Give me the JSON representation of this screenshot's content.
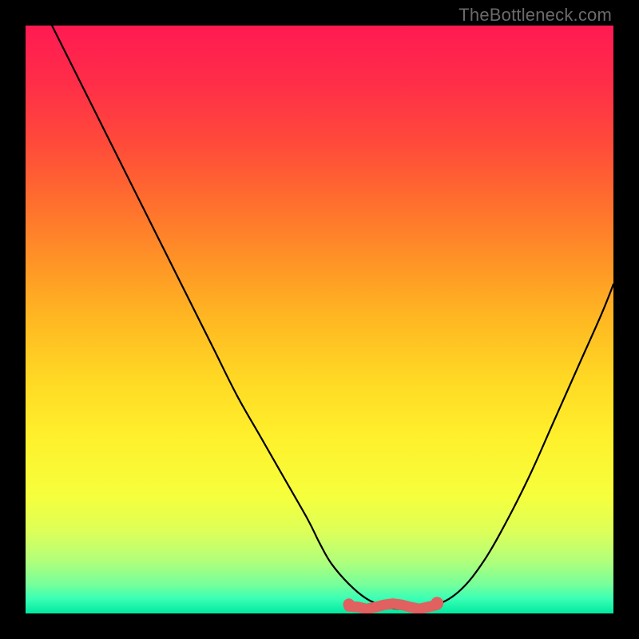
{
  "watermark": {
    "text": "TheBottleneck.com"
  },
  "gradient": {
    "stops": [
      {
        "offset": 0.0,
        "color": "#ff1a52"
      },
      {
        "offset": 0.1,
        "color": "#ff2e48"
      },
      {
        "offset": 0.2,
        "color": "#ff4a3a"
      },
      {
        "offset": 0.3,
        "color": "#ff6e2e"
      },
      {
        "offset": 0.4,
        "color": "#ff9326"
      },
      {
        "offset": 0.5,
        "color": "#ffb822"
      },
      {
        "offset": 0.6,
        "color": "#ffd824"
      },
      {
        "offset": 0.7,
        "color": "#fff02c"
      },
      {
        "offset": 0.8,
        "color": "#f6ff3c"
      },
      {
        "offset": 0.86,
        "color": "#ddff58"
      },
      {
        "offset": 0.91,
        "color": "#b2ff7a"
      },
      {
        "offset": 0.95,
        "color": "#78ff9a"
      },
      {
        "offset": 0.975,
        "color": "#3affb5"
      },
      {
        "offset": 1.0,
        "color": "#00e8a0"
      }
    ]
  },
  "chart_data": {
    "type": "line",
    "title": "",
    "xlabel": "",
    "ylabel": "",
    "xlim": [
      0,
      100
    ],
    "ylim": [
      0,
      100
    ],
    "series": [
      {
        "name": "bottleneck-curve",
        "x": [
          4.5,
          8,
          12,
          16,
          20,
          24,
          28,
          32,
          36,
          40,
          44,
          48,
          50,
          52,
          55,
          58,
          61,
          63,
          66,
          70,
          74,
          78,
          82,
          86,
          90,
          94,
          98,
          100
        ],
        "y": [
          100,
          93,
          85,
          77,
          69,
          61,
          53,
          45,
          37,
          30,
          23,
          16,
          12,
          8.5,
          5,
          2.5,
          1.2,
          0.8,
          0.8,
          1.5,
          4,
          9,
          16,
          24,
          33,
          42,
          51,
          56
        ]
      }
    ],
    "flat_region": {
      "name": "bottom-marker",
      "color": "#e16060",
      "x_start": 55,
      "x_end": 70,
      "y": 1.2,
      "thickness": 1.8
    }
  }
}
